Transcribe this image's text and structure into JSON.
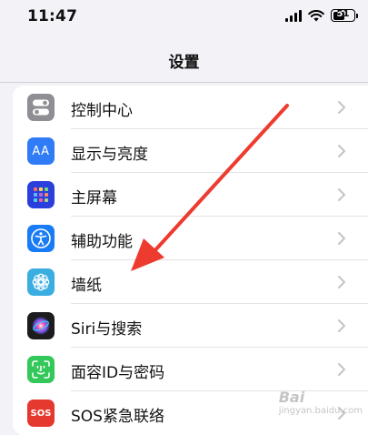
{
  "status_bar": {
    "time": "11:47",
    "battery": "51"
  },
  "nav": {
    "title": "设置"
  },
  "rows": [
    {
      "label": "控制中心",
      "icon": "control-center-icon",
      "color": "#8e8e93"
    },
    {
      "label": "显示与亮度",
      "icon": "display-brightness-icon",
      "color": "#2f7cf6",
      "glyph": "AA"
    },
    {
      "label": "主屏幕",
      "icon": "home-screen-icon",
      "color": "#2b3fdc"
    },
    {
      "label": "辅助功能",
      "icon": "accessibility-icon",
      "color": "#1a7cf5"
    },
    {
      "label": "墙纸",
      "icon": "wallpaper-icon",
      "color": "#3aaee0"
    },
    {
      "label": "Siri与搜索",
      "icon": "siri-icon",
      "color": "#1c1c1e"
    },
    {
      "label": "面容ID与密码",
      "icon": "face-id-icon",
      "color": "#34c759"
    },
    {
      "label": "SOS紧急联络",
      "icon": "sos-icon",
      "color": "#e5392f",
      "glyph": "SOS"
    }
  ],
  "annotation": {
    "color": "#ee3b2f"
  },
  "watermark": {
    "brand": "Bai",
    "sub": "jingyan.baidu.com"
  }
}
